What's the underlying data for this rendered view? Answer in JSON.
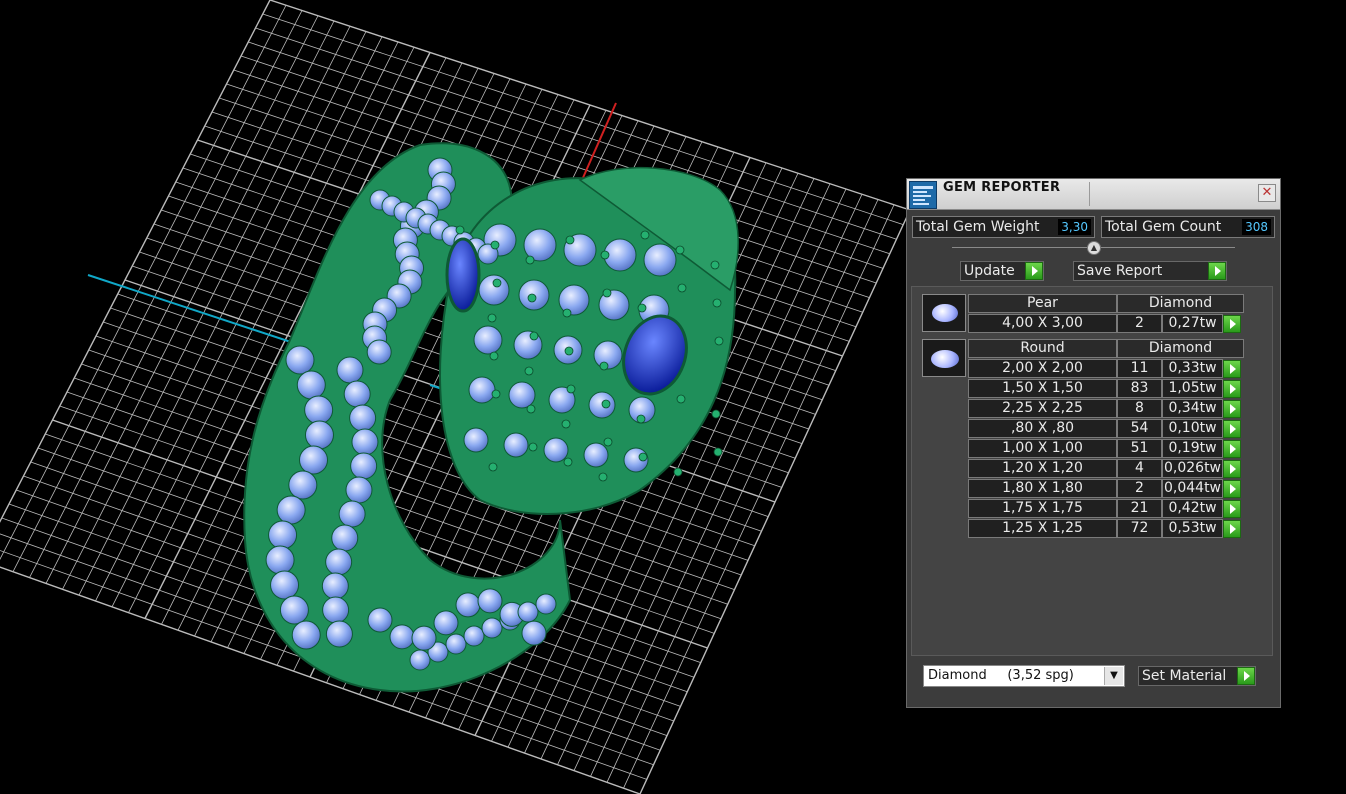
{
  "panel": {
    "title": "GEM REPORTER",
    "close_glyph": "✕",
    "total_weight_label": "Total Gem Weight",
    "total_weight_value": "3,30",
    "total_count_label": "Total Gem Count",
    "total_count_value": "308",
    "update_label": "Update",
    "save_report_label": "Save Report",
    "groups": [
      {
        "shape": "Pear",
        "material": "Diamond",
        "icon": "pear-gem-icon",
        "rows": [
          {
            "size": "4,00 X 3,00",
            "count": "2",
            "weight": "0,27tw"
          }
        ]
      },
      {
        "shape": "Round",
        "material": "Diamond",
        "icon": "round-gem-icon",
        "rows": [
          {
            "size": "2,00 X 2,00",
            "count": "11",
            "weight": "0,33tw"
          },
          {
            "size": "1,50 X 1,50",
            "count": "83",
            "weight": "1,05tw"
          },
          {
            "size": "2,25 X 2,25",
            "count": "8",
            "weight": "0,34tw"
          },
          {
            "size": ",80 X ,80",
            "count": "54",
            "weight": "0,10tw"
          },
          {
            "size": "1,00 X 1,00",
            "count": "51",
            "weight": "0,19tw"
          },
          {
            "size": "1,20 X 1,20",
            "count": "4",
            "weight": "0,026tw"
          },
          {
            "size": "1,80 X 1,80",
            "count": "2",
            "weight": "0,044tw"
          },
          {
            "size": "1,75 X 1,75",
            "count": "21",
            "weight": "0,42tw"
          },
          {
            "size": "1,25 X 1,25",
            "count": "72",
            "weight": "0,53tw"
          }
        ]
      }
    ],
    "material_select": "Diamond     (3,52 spg)",
    "set_material_label": "Set Material"
  },
  "colors": {
    "metal": "#1f8f5a",
    "gem": "#8aa8f0",
    "center_gem": "#1c3ac8",
    "grid": "#d8d8d8",
    "value_text": "#55c8ff",
    "accent_button": "#3cb82a"
  }
}
